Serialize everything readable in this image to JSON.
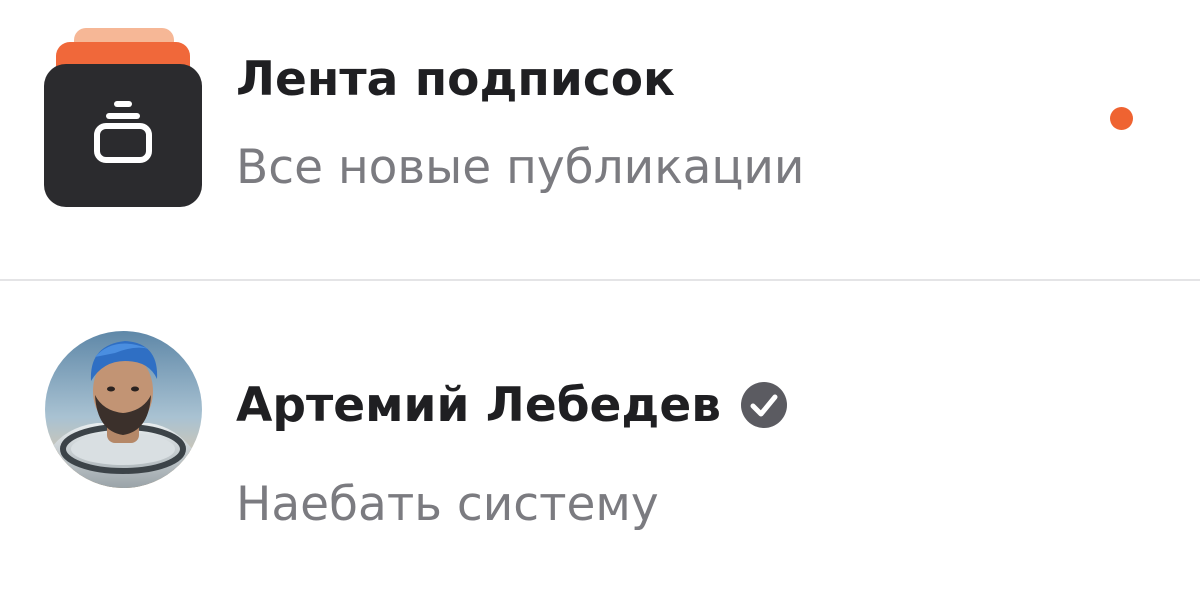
{
  "feed": {
    "title": "Лента подписок",
    "subtitle": "Все новые публикации",
    "icon": "feed-stack-icon",
    "has_unread": true,
    "unread_dot_color": "#ef6331"
  },
  "author": {
    "name": "Артемий Лебедев",
    "verified": true,
    "verified_icon": "verified-check-icon",
    "subtitle": "Наебать систему",
    "avatar": "author-avatar"
  },
  "colors": {
    "title": "#1f1f22",
    "subtitle": "#7b7b80",
    "accent": "#f0683a",
    "icon_dark": "#2b2b2e",
    "divider": "#e4e4e6"
  }
}
